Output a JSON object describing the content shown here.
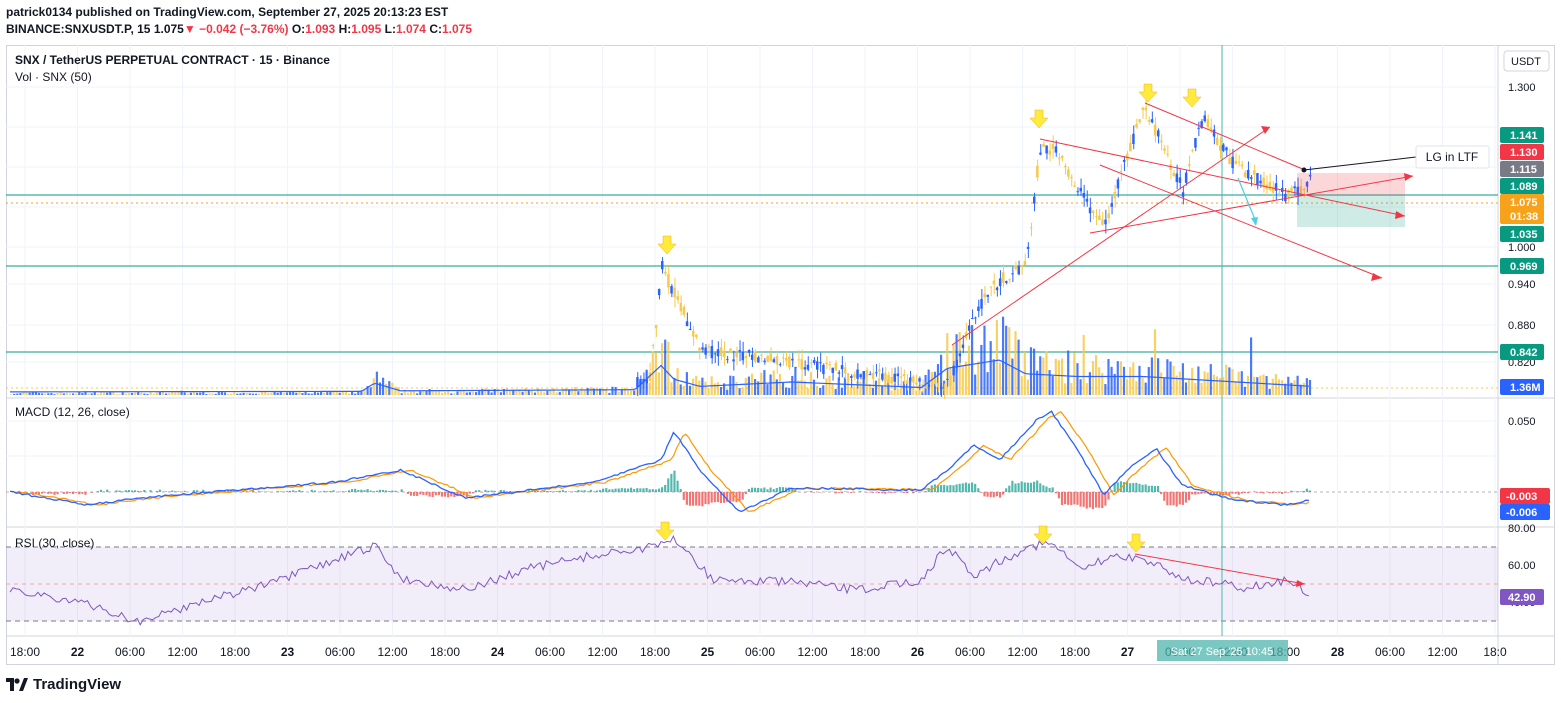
{
  "header": {
    "publisher_line": "patrick0134 published on TradingView.com, September 27, 2025 20:13:23 EST",
    "symbol": "BINANCE:SNXUSDT.P, 15",
    "last": "1.075",
    "change": "−0.042 (−3.76%)",
    "o_label": "O:",
    "o_value": "1.093",
    "h_label": "H:",
    "h_value": "1.095",
    "l_label": "L:",
    "l_value": "1.074",
    "c_label": "C:",
    "c_value": "1.075"
  },
  "chart": {
    "title": "SNX / TetherUS PERPETUAL CONTRACT · 15 · Binance",
    "volume_label": "Vol · SNX (50)",
    "currency_button": "USDT",
    "price_axis": [
      "1.300",
      "1.000",
      "0.940",
      "0.880",
      "0.820"
    ],
    "price_badges": [
      {
        "label": "1.141",
        "color": "#089981"
      },
      {
        "label": "1.130",
        "color": "#f23645"
      },
      {
        "label": "1.115",
        "color": "#787b86"
      },
      {
        "label": "1.089",
        "color": "#089981"
      },
      {
        "label": "1.075",
        "color": "#f7a21b"
      },
      {
        "label": "01:38",
        "color": "#f7a21b"
      },
      {
        "label": "1.035",
        "color": "#089981"
      },
      {
        "label": "0.969",
        "color": "#089981"
      },
      {
        "label": "0.842",
        "color": "#089981"
      },
      {
        "label": "1.36M",
        "color": "#2962ff"
      }
    ],
    "annotation": "LG in LTF"
  },
  "macd": {
    "label": "MACD (12, 26, close)",
    "axis": [
      "0.050",
      "0.000"
    ],
    "badges": [
      {
        "label": "-0.003",
        "color": "#f23645"
      },
      {
        "label": "-0.006",
        "color": "#2962ff"
      }
    ]
  },
  "rsi": {
    "label": "RSI (30, close)",
    "axis": [
      "80.00",
      "60.00",
      "40.00"
    ],
    "badge": "42.90",
    "badge_color": "#7e57c2"
  },
  "time_axis": {
    "labels": [
      "18:00",
      "22",
      "06:00",
      "12:00",
      "18:00",
      "23",
      "06:00",
      "12:00",
      "18:00",
      "24",
      "06:00",
      "12:00",
      "18:00",
      "25",
      "06:00",
      "12:00",
      "18:00",
      "26",
      "06:00",
      "12:00",
      "18:00",
      "27",
      "06:00",
      "12:00",
      "18:00",
      "28",
      "06:00",
      "12:00",
      "18:0"
    ],
    "cursor_label": "Sat 27 Sep '25  10:45"
  },
  "footer": {
    "brand": "TradingView",
    "logo_icon": "tradingview-logo-icon"
  },
  "colors": {
    "up": "#2962ff",
    "down": "#f7c948",
    "support": "#089981",
    "trendline": "#f23645",
    "rsi": "#7e57c2",
    "macd": "#2962ff",
    "signal": "#ff9800",
    "arrow": "#ffeb3b"
  }
}
